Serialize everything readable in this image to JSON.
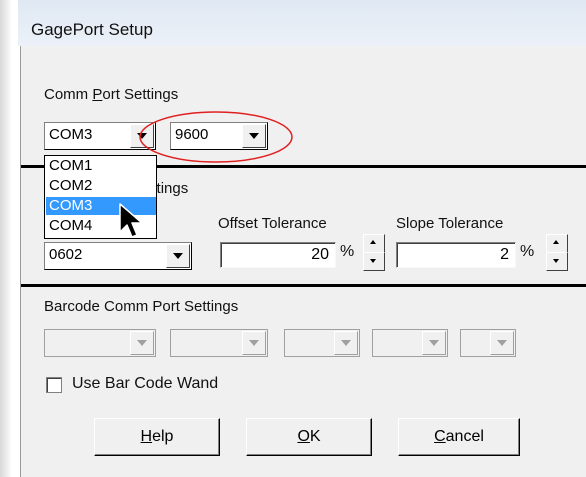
{
  "window": {
    "title": "GagePort Setup"
  },
  "comm_port": {
    "section_label_pre": "Comm ",
    "section_label_underline": "P",
    "section_label_post": "ort Settings",
    "port_value": "COM3",
    "baud_value": "9600",
    "dropdown_options": [
      "COM1",
      "COM2",
      "COM3",
      "COM4"
    ],
    "selected_option": "COM3"
  },
  "tolerance": {
    "section_label_partial": "ce Settings",
    "size_value": "0602",
    "offset_label": "Offset Tolerance",
    "offset_value": "20",
    "offset_unit": "%",
    "slope_label": "Slope Tolerance",
    "slope_value": "2",
    "slope_unit": "%"
  },
  "barcode": {
    "section_label": "Barcode Comm Port Settings",
    "checkbox_label": "Use Bar Code Wand",
    "checkbox_checked": false
  },
  "buttons": {
    "help_underline": "H",
    "help_rest": "elp",
    "ok_underline": "O",
    "ok_rest": "K",
    "cancel_underline": "C",
    "cancel_rest": "ancel"
  },
  "colors": {
    "highlight": "#3399ff",
    "annotation_circle": "#e02020"
  }
}
